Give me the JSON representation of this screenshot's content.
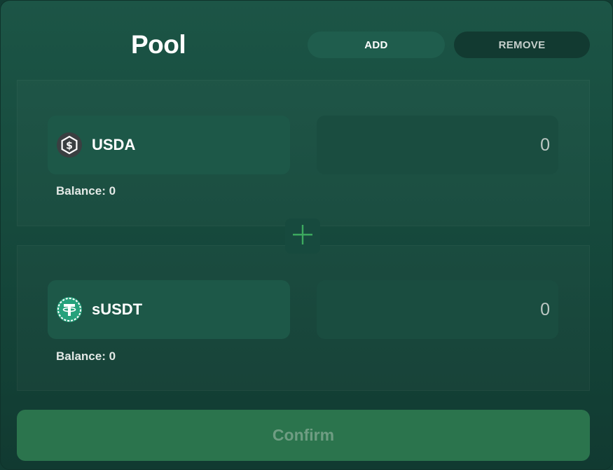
{
  "header": {
    "title": "Pool",
    "tabs": [
      {
        "label": "ADD",
        "active": true
      },
      {
        "label": "REMOVE",
        "active": false
      }
    ]
  },
  "pool": {
    "token_a": {
      "symbol": "USDA",
      "icon": "usda-token-icon",
      "amount": "0",
      "balance_text": "Balance: 0"
    },
    "token_b": {
      "symbol": "sUSDT",
      "icon": "tether-token-icon",
      "amount": "0",
      "balance_text": "Balance: 0"
    },
    "divider_icon": "plus-icon"
  },
  "footer": {
    "confirm_label": "Confirm"
  },
  "colors": {
    "card_bg": "#1c5546",
    "accent_green": "#2b744d",
    "plus_green": "#3daa5f",
    "tether_green": "#26a17b"
  }
}
